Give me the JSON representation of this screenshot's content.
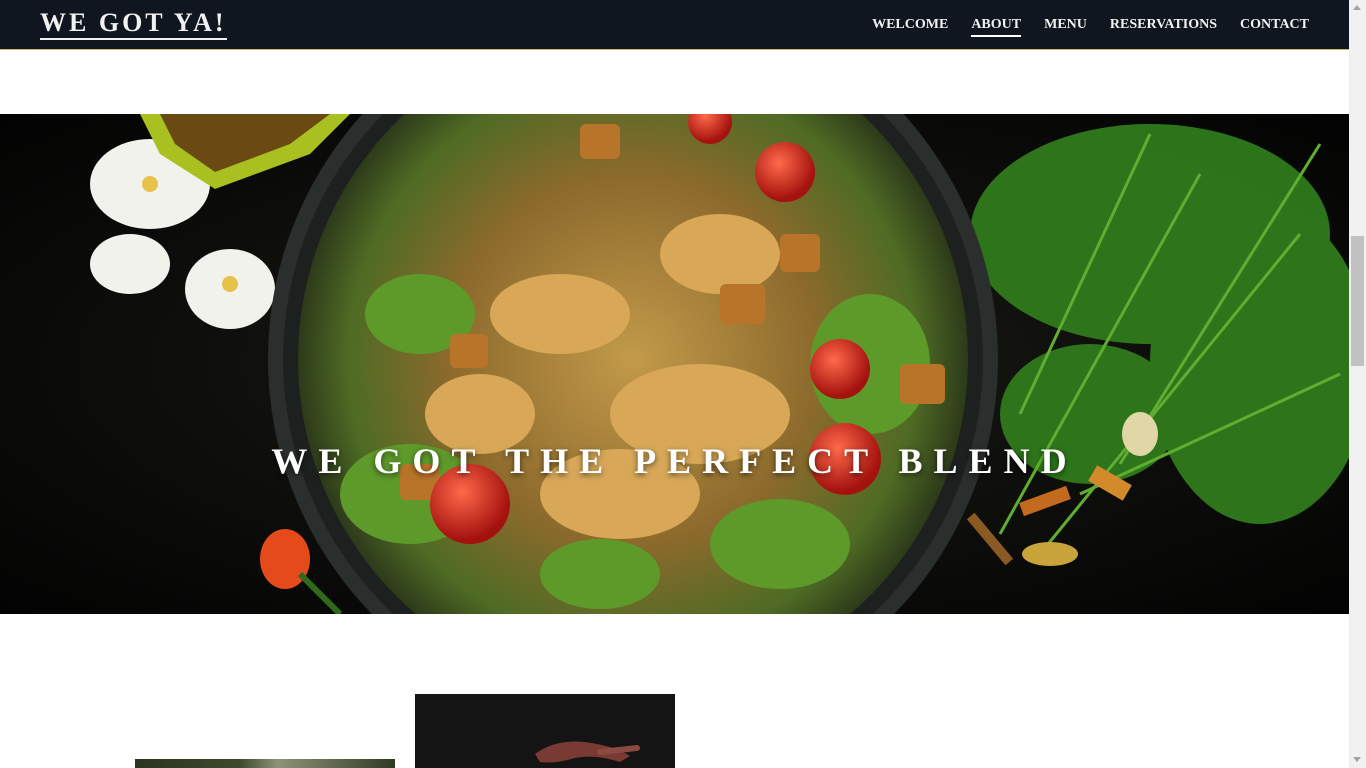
{
  "brand": {
    "name": "WE GOT YA!"
  },
  "nav": {
    "items": [
      {
        "label": "WELCOME"
      },
      {
        "label": "ABOUT",
        "active": true
      },
      {
        "label": "MENU"
      },
      {
        "label": "RESERVATIONS"
      },
      {
        "label": "CONTACT"
      }
    ]
  },
  "hero": {
    "title": "WE GOT THE PERFECT BLEND",
    "image": "salad-bowl-photo"
  },
  "gallery": {
    "images": [
      "food-photo",
      "hand-on-dark-background-photo"
    ]
  },
  "colors": {
    "navbar_bg": "#0f1620",
    "nav_text": "#f1f1f1",
    "accent_border": "#c9b86a",
    "page_bg": "#ffffff"
  }
}
